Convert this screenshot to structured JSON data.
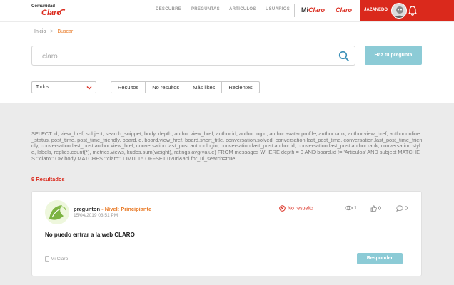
{
  "header": {
    "logo_top": "Comunidad",
    "logo_bottom": "Claro",
    "nav": [
      "DESCUBRE",
      "PREGUNTAS",
      "ARTÍCULOS",
      "USUARIOS"
    ],
    "brand_mi": "Mi",
    "brand_claro1": "Claro",
    "brand_claro2": "Claro",
    "username": "JAZANEDO",
    "accent_color": "#da291c"
  },
  "breadcrumb": {
    "home": "Inicio",
    "separator": ">",
    "current": "Buscar"
  },
  "search": {
    "value": "claro",
    "placeholder": "claro"
  },
  "ask_button": "Haz tu pregunta",
  "filter_select": {
    "selected": "Todos"
  },
  "filter_tabs": [
    "Resultos",
    "No resultos",
    "Más likes",
    "Recientes"
  ],
  "query_text": "SELECT id, view_href, subject, search_snippet, body, depth, author.view_href, author.id, author.login, author.avatar.profile, author.rank, author.view_href, author.online_status, post_time, post_time_friendly, board.id, board.view_href, board.short_title, conversation.solved, conversation.last_post_time, conversation.last_post_time_friendly, conversation.last_post.author.view_href, conversation.last_post.author.login, conversation.last_post.author.id, conversation.last_post.author.rank, conversation.style, labels, replies.count(*), metrics.views, kudos.sum(weight), ratings.avg(value) FROM messages WHERE depth = 0 AND board.id != 'Articulos' AND subject MATCHES '\"claro\"' OR body MATCHES '\"claro\"' LIMIT 15 OFFSET 0?url&api.for_ui_search=true",
  "results_count": "9 Resultados",
  "result": {
    "author": "pregunton",
    "level": "Nivel: Principiante",
    "level_prefix": " - ",
    "date": "15/04/2019 03:51 PM",
    "status": "No resuelto",
    "views": "1",
    "likes": "0",
    "comments": "0",
    "title": "No puedo entrar a la web CLARO",
    "category": "Mi Claro",
    "reply_button": "Responder"
  }
}
